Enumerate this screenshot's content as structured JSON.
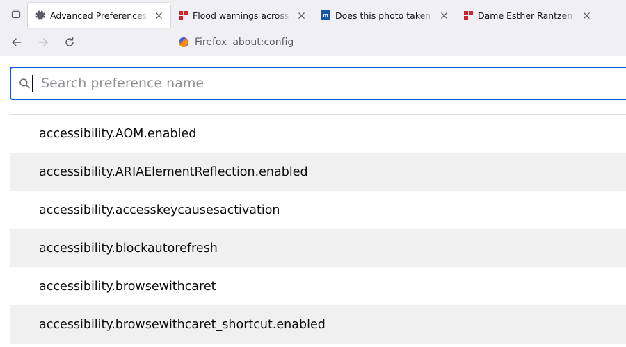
{
  "tabs": [
    {
      "label": "Advanced Preferences",
      "type": "gear",
      "active": true
    },
    {
      "label": "Flood warnings across England",
      "type": "bbc",
      "active": false
    },
    {
      "label": "Does this photo taken in Chicago",
      "type": "m",
      "active": false
    },
    {
      "label": "Dame Esther Rantzen pays tribute",
      "type": "bbc",
      "active": false
    }
  ],
  "nav": {
    "identity_label": "Firefox",
    "url": "about:config"
  },
  "search": {
    "placeholder": "Search preference name"
  },
  "prefs": [
    {
      "name": "accessibility.AOM.enabled"
    },
    {
      "name": "accessibility.ARIAElementReflection.enabled"
    },
    {
      "name": "accessibility.accesskeycausesactivation"
    },
    {
      "name": "accessibility.blockautorefresh"
    },
    {
      "name": "accessibility.browsewithcaret"
    },
    {
      "name": "accessibility.browsewithcaret_shortcut.enabled"
    }
  ]
}
